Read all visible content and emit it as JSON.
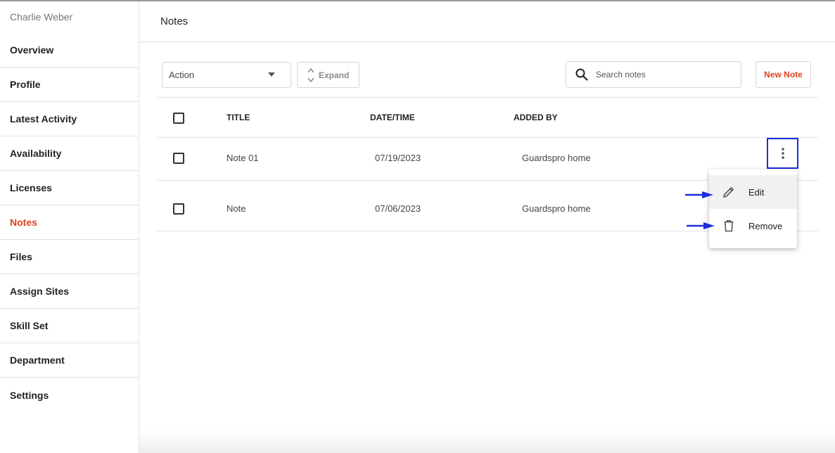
{
  "sidebar": {
    "user_name": "Charlie Weber",
    "items": [
      {
        "label": "Overview"
      },
      {
        "label": "Profile"
      },
      {
        "label": "Latest Activity"
      },
      {
        "label": "Availability"
      },
      {
        "label": "Licenses"
      },
      {
        "label": "Notes",
        "active": true
      },
      {
        "label": "Files"
      },
      {
        "label": "Assign Sites"
      },
      {
        "label": "Skill Set"
      },
      {
        "label": "Department"
      },
      {
        "label": "Settings"
      }
    ],
    "active_color": "#e0401f"
  },
  "header": {
    "title": "Notes"
  },
  "toolbar": {
    "action_label": "Action",
    "expand_label": "Expand",
    "search_placeholder": "Search notes",
    "new_note_label": "New Note"
  },
  "table": {
    "columns": [
      "TITLE",
      "DATE/TIME",
      "ADDED BY"
    ],
    "rows": [
      {
        "title": "Note 01",
        "datetime": "07/19/2023",
        "added_by": "Guardspro home"
      },
      {
        "title": "Note",
        "datetime": "07/06/2023",
        "added_by": "Guardspro home"
      }
    ]
  },
  "context_menu": {
    "items": [
      {
        "label": "Edit",
        "icon": "pencil-icon"
      },
      {
        "label": "Remove",
        "icon": "trash-icon"
      }
    ]
  },
  "colors": {
    "accent": "#e0401f",
    "highlight_border": "#1a2fd8"
  }
}
